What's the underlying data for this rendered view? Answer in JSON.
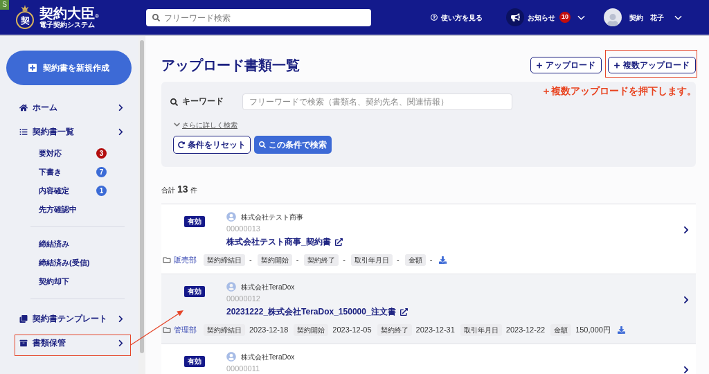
{
  "corner_badge": "S",
  "header": {
    "logo": {
      "emblem": "契",
      "title": "契約大臣",
      "mark": "®",
      "subtitle": "電子契約システム"
    },
    "search": {
      "placeholder": "フリーワード検索"
    },
    "help_link": "使い方を見る",
    "notifications": {
      "label": "お知らせ",
      "count": "10"
    },
    "user": {
      "name": "契約　花子"
    }
  },
  "sidebar": {
    "create_button": "契約書を新規作成",
    "nav": [
      {
        "label": "ホーム"
      },
      {
        "label": "契約書一覧",
        "children": [
          {
            "label": "要対応",
            "count": "3",
            "color": "#b30f0f",
            "divider_after": false
          },
          {
            "label": "下書き",
            "count": "7",
            "color": "#3b6bd6",
            "divider_after": false
          },
          {
            "label": "内容確定",
            "count": "1",
            "color": "#3b6bd6",
            "divider_after": false
          },
          {
            "label": "先方確認中",
            "divider_after": true
          },
          {
            "label": "締結済み",
            "divider_after": false
          },
          {
            "label": "締結済み(受信)",
            "divider_after": false
          },
          {
            "label": "契約却下",
            "divider_after": true
          }
        ]
      },
      {
        "label": "契約書テンプレート"
      },
      {
        "label": "書類保管"
      }
    ]
  },
  "page": {
    "title": "アップロード書類一覧",
    "actions": [
      "アップロード",
      "複数アップロード"
    ]
  },
  "search_panel": {
    "keyword_label": "キーワード",
    "keyword_field": {
      "placeholder": "フリーワードで検索（書類名、契約先名、関連情報）"
    },
    "advanced_link": "さらに詳しく検索",
    "buttons": [
      {
        "label": "条件をリセット",
        "kind": "reset"
      },
      {
        "label": "この条件で検索",
        "kind": "submit"
      }
    ]
  },
  "result_count": {
    "label": "合計",
    "count": "13",
    "unit": "件"
  },
  "documents": [
    {
      "status": "有効",
      "company": "株式会社テスト商事",
      "number": "00000013",
      "title": "株式会社テスト商事_契約書",
      "department": "販売部",
      "fields": [
        {
          "label": "契約締結日",
          "value": "-"
        },
        {
          "label": "契約開始",
          "value": "-"
        },
        {
          "label": "契約終了",
          "value": "-"
        },
        {
          "label": "取引年月日",
          "value": "-"
        },
        {
          "label": "金額",
          "value": "-"
        }
      ],
      "highlighted": false
    },
    {
      "status": "有効",
      "company": "株式会社TeraDox",
      "number": "00000012",
      "title": "20231222_株式会社TeraDox_150000_注文書",
      "department": "管理部",
      "fields": [
        {
          "label": "契約締結日",
          "value": "2023-12-18"
        },
        {
          "label": "契約開始",
          "value": "2023-12-05"
        },
        {
          "label": "契約終了",
          "value": "2023-12-31"
        },
        {
          "label": "取引年月日",
          "value": "2023-12-22"
        },
        {
          "label": "金額",
          "value": "150,000円"
        }
      ],
      "highlighted": true
    },
    {
      "status": "有効",
      "company": "株式会社TeraDox",
      "number": "00000011",
      "highlighted": false
    }
  ],
  "annotation": {
    "note": "＋複数アップロードを押下します。"
  }
}
